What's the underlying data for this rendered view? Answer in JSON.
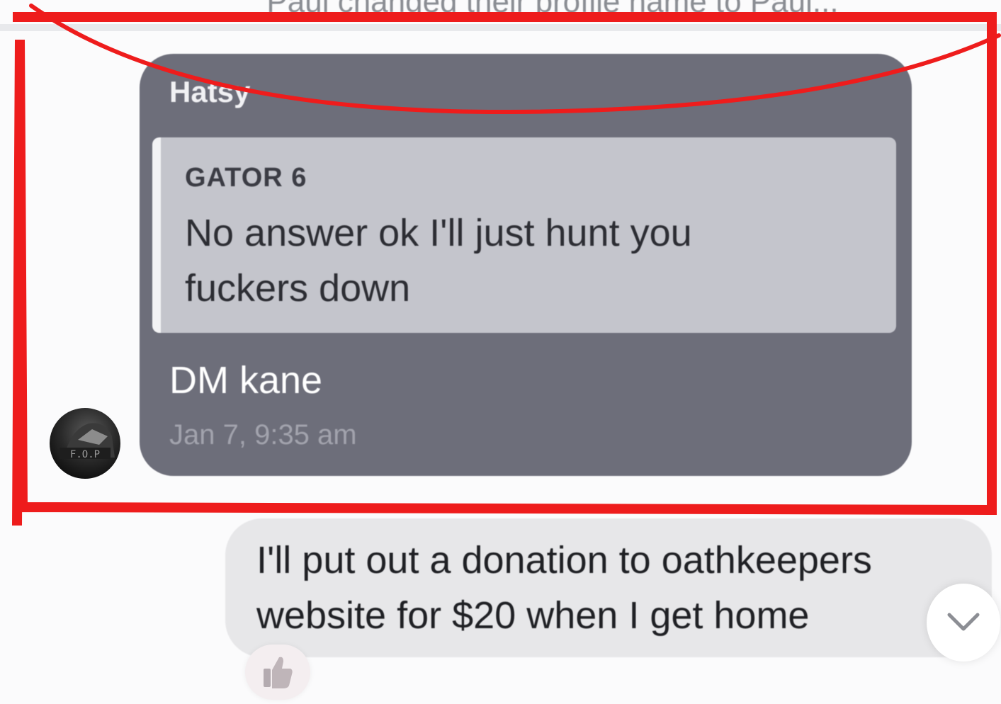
{
  "system_notice": "Paul changed their profile name to Paul...",
  "received_message": {
    "sender": "Hatsy",
    "quote": {
      "author": "GATOR 6",
      "text": "No answer ok I'll just hunt you fuckers down"
    },
    "text": "DM kane",
    "timestamp": "Jan 7, 9:35 am",
    "avatar_caption": "F.O.P"
  },
  "sent_message": {
    "text": "I'll put out a donation to oathkeepers website for $20 when I get home",
    "reaction_icon": "thumbs-up-icon"
  },
  "icons": {
    "options": "chevron-down-icon",
    "reaction": "thumbs-up-icon"
  },
  "colors": {
    "annotation": "#ee1c1c",
    "received_bubble": "#6d6e7a",
    "quote_block": "#c4c5cc",
    "sent_bubble": "#e7e7e9"
  }
}
